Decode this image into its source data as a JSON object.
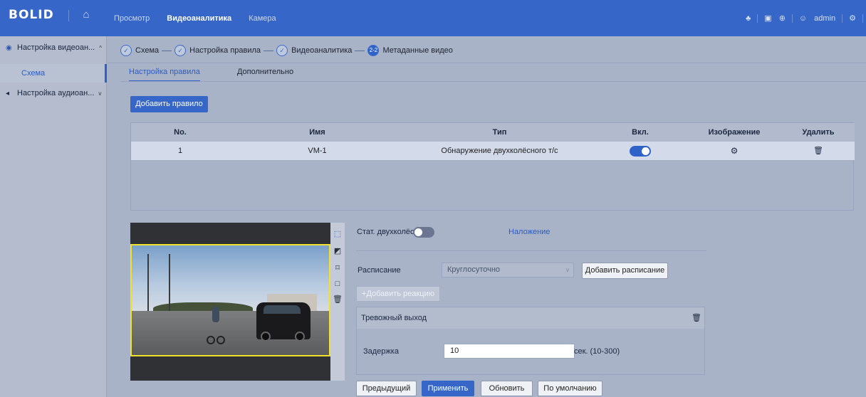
{
  "header": {
    "logo": "BOLID",
    "nav": [
      "Просмотр",
      "Видеоаналитика",
      "Камера"
    ],
    "active_nav": "Видеоаналитика",
    "user": "admin",
    "right_icons": [
      "bell-icon",
      "monitor-icon",
      "globe-icon",
      "user-icon",
      "gear-icon"
    ]
  },
  "sidebar": {
    "groups": [
      {
        "label": "Настройка видеоан...",
        "icon": "camera-icon",
        "expanded": true,
        "items": [
          "Схема"
        ]
      },
      {
        "label": "Настройка аудиоан...",
        "icon": "speaker-icon",
        "expanded": false,
        "items": []
      }
    ],
    "active_item": "Схема"
  },
  "steps": [
    {
      "label": "Схема",
      "done": true
    },
    {
      "label": "Настройка правила",
      "done": true
    },
    {
      "label": "Видеоаналитика",
      "done": true
    },
    {
      "label": "Метаданные видео",
      "done": false,
      "badge": "2-2"
    }
  ],
  "tabs": [
    "Настройка правила",
    "Дополнительно"
  ],
  "active_tab": "Настройка правила",
  "add_rule_label": "Добавить правило",
  "table": {
    "columns": [
      "No.",
      "Имя",
      "Тип",
      "Вкл.",
      "Изображение",
      "Удалить"
    ],
    "rows": [
      {
        "no": "1",
        "name": "VM-1",
        "type": "Обнаружение двухколёсного т/с",
        "enabled": true
      }
    ]
  },
  "panel": {
    "stat_label": "Стат. двухколёс...",
    "stat_enabled": false,
    "overlay_link": "Наложение",
    "schedule_label": "Расписание",
    "schedule_value": "Круглосуточно",
    "add_schedule": "Добавить расписание",
    "add_reaction": "+Добавить реакцию",
    "alarm_output": "Тревожный выход",
    "delay_label": "Задержка",
    "delay_value": "10",
    "delay_unit": "сек. (10-300)"
  },
  "footer": {
    "prev": "Предыдущий",
    "apply": "Применить",
    "refresh": "Обновить",
    "default": "По умолчанию"
  },
  "colors": {
    "header_bg": "#3566c8",
    "accent": "#2f62c9",
    "page_bg": "#a9b3c8",
    "roi_frame": "#f0e22c"
  }
}
